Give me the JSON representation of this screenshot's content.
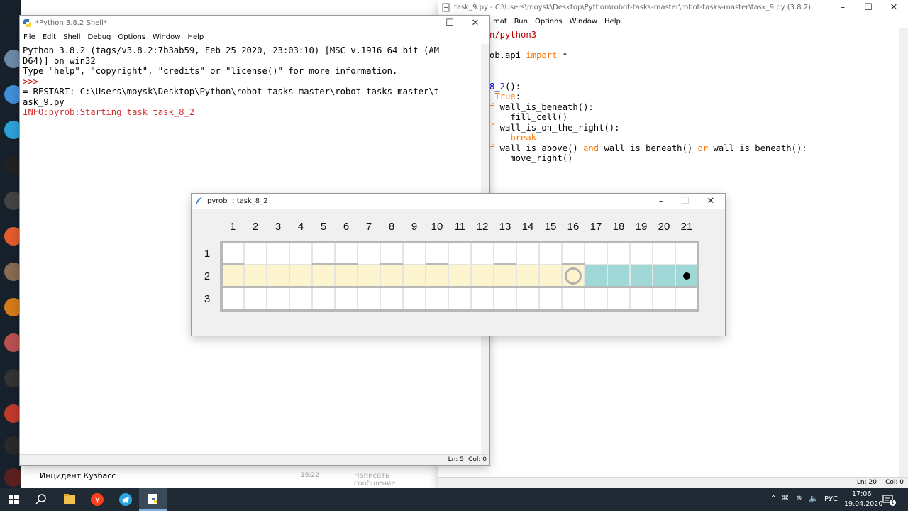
{
  "shell": {
    "title": "*Python 3.8.2 Shell*",
    "menu": [
      "File",
      "Edit",
      "Shell",
      "Debug",
      "Options",
      "Window",
      "Help"
    ],
    "lines": [
      {
        "text": "Python 3.8.2 (tags/v3.8.2:7b3ab59, Feb 25 2020, 23:03:10) [MSC v.1916 64 bit (AM",
        "color": "#000000"
      },
      {
        "text": "D64)] on win32",
        "color": "#000000"
      },
      {
        "text": "Type \"help\", \"copyright\", \"credits\" or \"license()\" for more information.",
        "color": "#000000"
      },
      {
        "text": ">>> ",
        "color": "#c00000"
      },
      {
        "text": "= RESTART: C:\\Users\\moysk\\Desktop\\Python\\robot-tasks-master\\robot-tasks-master\\t",
        "color": "#000000"
      },
      {
        "text": "ask_9.py",
        "color": "#000000"
      },
      {
        "text": "INFO:pyrob:Starting task task_8_2",
        "color": "#d32f2f"
      }
    ],
    "status_ln": "Ln: 5",
    "status_col": "Col: 0"
  },
  "editor": {
    "title": "task_9.py - C:\\Users\\moysk\\Desktop\\Python\\robot-tasks-master\\robot-tasks-master\\task_9.py (3.8.2)",
    "menu": [
      "mat",
      "Run",
      "Options",
      "Window",
      "Help"
    ],
    "code": [
      [
        {
          "t": "n/python3",
          "c": "#c00000"
        }
      ],
      [],
      [
        {
          "t": "ob.api ",
          "c": "#000000"
        },
        {
          "t": "import",
          "c": "#ff7700"
        },
        {
          "t": " *",
          "c": "#000000"
        }
      ],
      [],
      [],
      [
        {
          "t": "8_2",
          "c": "#0000ff"
        },
        {
          "t": "():",
          "c": "#000000"
        }
      ],
      [
        {
          "t": " True",
          "c": "#ff7700"
        },
        {
          "t": ":",
          "c": "#000000"
        }
      ],
      [
        {
          "t": "f",
          "c": "#ff7700"
        },
        {
          "t": " wall_is_beneath():",
          "c": "#000000"
        }
      ],
      [
        {
          "t": "    fill_cell()",
          "c": "#000000"
        }
      ],
      [
        {
          "t": "f",
          "c": "#ff7700"
        },
        {
          "t": " wall_is_on_the_right():",
          "c": "#000000"
        }
      ],
      [
        {
          "t": "    break",
          "c": "#ff7700"
        }
      ],
      [
        {
          "t": "f",
          "c": "#ff7700"
        },
        {
          "t": " wall_is_above() ",
          "c": "#000000"
        },
        {
          "t": "and",
          "c": "#ff7700"
        },
        {
          "t": " wall_is_beneath() ",
          "c": "#000000"
        },
        {
          "t": "or",
          "c": "#ff7700"
        },
        {
          "t": " wall_is_beneath():",
          "c": "#000000"
        }
      ],
      [
        {
          "t": "    move_right()",
          "c": "#000000"
        }
      ]
    ],
    "status_ln": "Ln: 20",
    "status_col": "Col: 0"
  },
  "robot": {
    "title": "pyrob :: task_8_2",
    "columns": [
      "1",
      "2",
      "3",
      "4",
      "5",
      "6",
      "7",
      "8",
      "9",
      "10",
      "11",
      "12",
      "13",
      "14",
      "15",
      "16",
      "17",
      "18",
      "19",
      "20",
      "21"
    ],
    "rows": [
      "1",
      "2",
      "3"
    ],
    "filled_row2_yellow_cols": 15,
    "filled_row2_teal_from_col": 17,
    "robot_col": 16,
    "target_col": 21,
    "upper_wall_cols": [
      1,
      5,
      6,
      8,
      10,
      13,
      16
    ],
    "colors": {
      "yellow": "#fdf5cf",
      "teal": "#a0d8d8",
      "wall": "#b8b8b8"
    }
  },
  "chat": {
    "channel": "Инцидент Кузбасс",
    "time": "16:22",
    "input_placeholder": "Написать сообщение..."
  },
  "taskbar": {
    "lang": "РУС",
    "time": "17:06",
    "date": "19.04.2020",
    "notification_count": "1"
  }
}
